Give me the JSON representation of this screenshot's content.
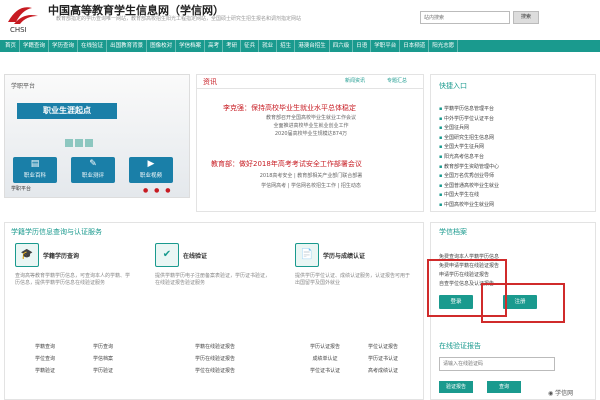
{
  "header": {
    "logo_text": "CHSI",
    "site_title": "中国高等教育学生信息网（学信网）",
    "site_subtitle": "教育部指定的学历查询唯一网站，教育部高校招生阳光工程指定网站，全国硕士研究生招生报名和调剂指定网站",
    "search_placeholder": "站内搜索",
    "search_button": "搜索"
  },
  "nav": {
    "items": [
      "首页",
      "学籍查询",
      "学历查询",
      "在线验证",
      "出国教育背景",
      "图像校对",
      "学信档案",
      "高考",
      "考研",
      "征兵",
      "就业",
      "招生",
      "港澳台招生",
      "四六级",
      "日语",
      "学职平台",
      "日本频道",
      "阳光志愿"
    ]
  },
  "banner": {
    "brand": "学职平台",
    "title": "职业生涯起点",
    "buttons": [
      "职业百科",
      "职业测评",
      "职业视频"
    ],
    "footer": "学职平台",
    "dots": "● ● ●"
  },
  "info": {
    "title": "资讯",
    "more1": "新闻资讯",
    "more2": "专题汇总",
    "news1": {
      "headline": "李克强：保持高校毕业生就业水平总体稳定",
      "lines": [
        "教育部召开全国高校毕业生就业工作会议",
        "全面推进高校毕业生就业创业工作",
        "2020届高校毕业生规模达874万"
      ]
    },
    "news2": {
      "headline": "教育部：做好2018年高考考试安全工作部署会议",
      "lines": [
        "2018高考安全 | 教育部相关产业部门联合部署",
        "学信网高考 | 学信网名校招生工作 | 招生动态"
      ]
    }
  },
  "quick": {
    "title": "快捷入口",
    "links": [
      "学籍学历信息管理平台",
      "中外学历学位认证平台",
      "全国征兵网",
      "全国研究生招生信息网",
      "全国大学生征兵网",
      "阳光高考信息平台",
      "教育部学生资助管理中心",
      "全国万名优秀创业导师",
      "全国普通高校毕业生就业",
      "中国大学生在线",
      "中国高校毕业生就业网"
    ]
  },
  "services": {
    "title": "学籍学历信息查询与认证服务",
    "cards": [
      {
        "icon": "🎓",
        "title": "学籍学历查询",
        "desc": "查询高等教育学籍学历信息，可查询本人的学籍、学历信息，提供学籍学历信息在线验证服务",
        "items": [
          "学籍查询",
          "学历查询",
          "学位查询",
          "学信档案",
          "学籍验证",
          "学历验证"
        ]
      },
      {
        "icon": "✔",
        "title": "在线验证",
        "desc": "提供学籍学历电子注册备案表验证，学历证书验证，在线验证报告验证服务",
        "items": [
          "学籍在线验证报告",
          "学历在线验证报告",
          "学位在线验证报告"
        ]
      },
      {
        "icon": "📄",
        "title": "学历与成绩认证",
        "desc": "提供学历学位认证、成绩认证服务，认证报告可用于出国留学及国外就业",
        "items": [
          "学历认证报告",
          "学位认证报告",
          "成绩单认证",
          "学历证书认证",
          "学位证书认证",
          "高考成绩认证"
        ]
      }
    ]
  },
  "login": {
    "title": "学信档案",
    "lines": [
      "免费查询本人学籍学历信息",
      "免费申请学籍在线验证报告",
      "申请学历在线验证报告",
      "自查学位信息及认证报告"
    ],
    "login_button": "登录",
    "register_button": "注册"
  },
  "online": {
    "title": "在线验证报告",
    "input_placeholder": "请输入在线验证码",
    "button1": "验证报告",
    "button2": "查询"
  },
  "watermark": "学信网"
}
